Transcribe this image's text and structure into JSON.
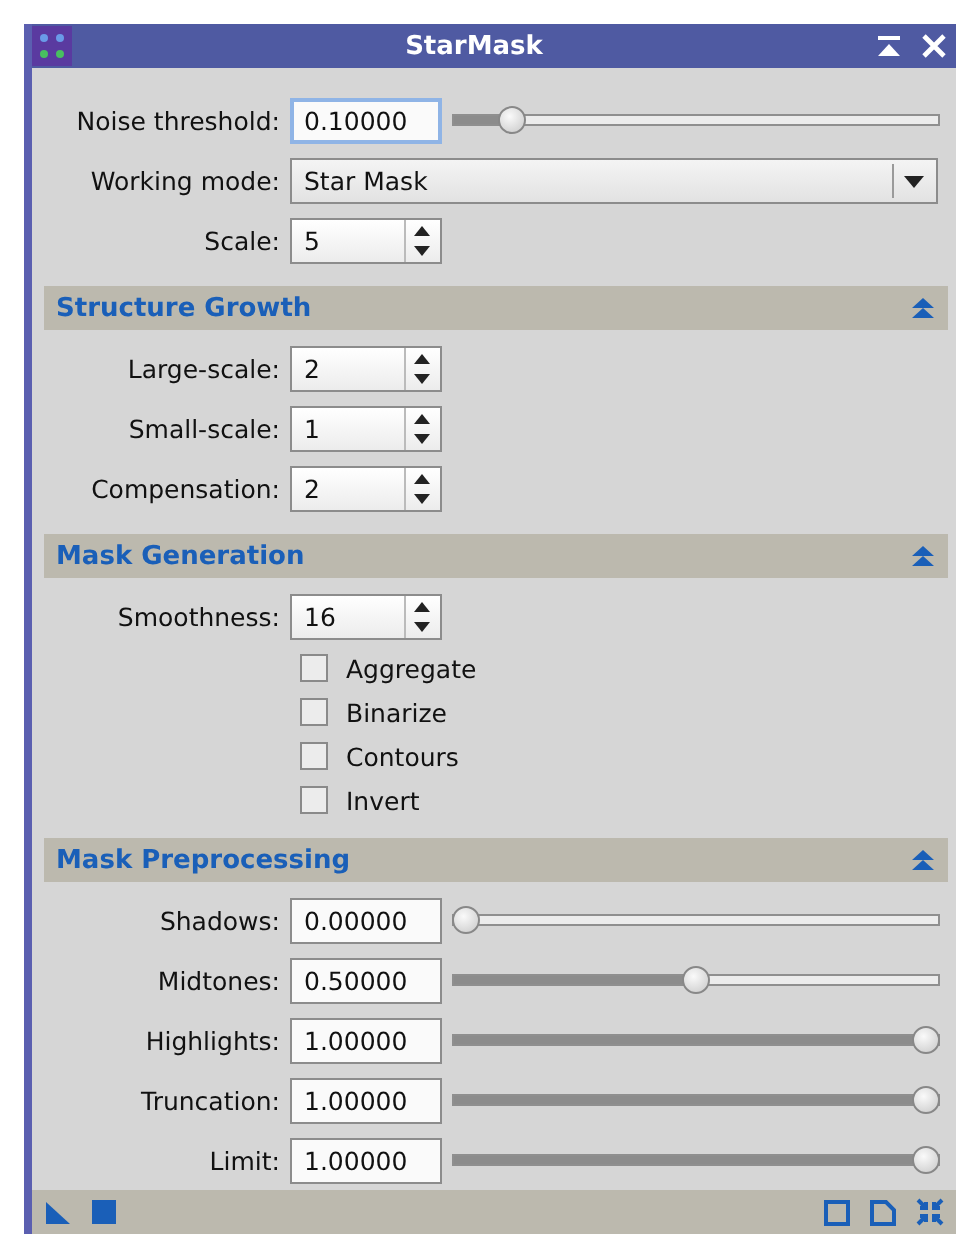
{
  "window": {
    "title": "StarMask"
  },
  "top_rows": [
    {
      "kind": "slider",
      "label": "Noise threshold:",
      "value": "0.10000",
      "level": 0.1,
      "focused": true
    },
    {
      "kind": "combo",
      "label": "Working mode:",
      "value": "Star Mask",
      "focused": false
    },
    {
      "kind": "spin",
      "label": "Scale:",
      "value": "5",
      "focused": false
    }
  ],
  "sections": [
    {
      "title": "Structure Growth",
      "expanded": true,
      "rows": [
        {
          "kind": "spin",
          "label": "Large-scale:",
          "value": "2",
          "focused": false
        },
        {
          "kind": "spin",
          "label": "Small-scale:",
          "value": "1",
          "focused": false
        },
        {
          "kind": "spin",
          "label": "Compensation:",
          "value": "2",
          "focused": false
        }
      ]
    },
    {
      "title": "Mask Generation",
      "expanded": true,
      "rows": [
        {
          "kind": "spin",
          "label": "Smoothness:",
          "value": "16",
          "focused": false
        },
        {
          "kind": "checkbox",
          "label": "Aggregate",
          "checked": false
        },
        {
          "kind": "checkbox",
          "label": "Binarize",
          "checked": false
        },
        {
          "kind": "checkbox",
          "label": "Contours",
          "checked": false
        },
        {
          "kind": "checkbox",
          "label": "Invert",
          "checked": false
        }
      ]
    },
    {
      "title": "Mask Preprocessing",
      "expanded": true,
      "rows": [
        {
          "kind": "slider",
          "label": "Shadows:",
          "value": "0.00000",
          "level": 0,
          "focused": false
        },
        {
          "kind": "slider",
          "label": "Midtones:",
          "value": "0.50000",
          "level": 0.5,
          "focused": false
        },
        {
          "kind": "slider",
          "label": "Highlights:",
          "value": "1.00000",
          "level": 1,
          "focused": false
        },
        {
          "kind": "slider",
          "label": "Truncation:",
          "value": "1.00000",
          "level": 1,
          "focused": false
        },
        {
          "kind": "slider",
          "label": "Limit:",
          "value": "1.00000",
          "level": 1,
          "focused": false
        }
      ]
    }
  ]
}
